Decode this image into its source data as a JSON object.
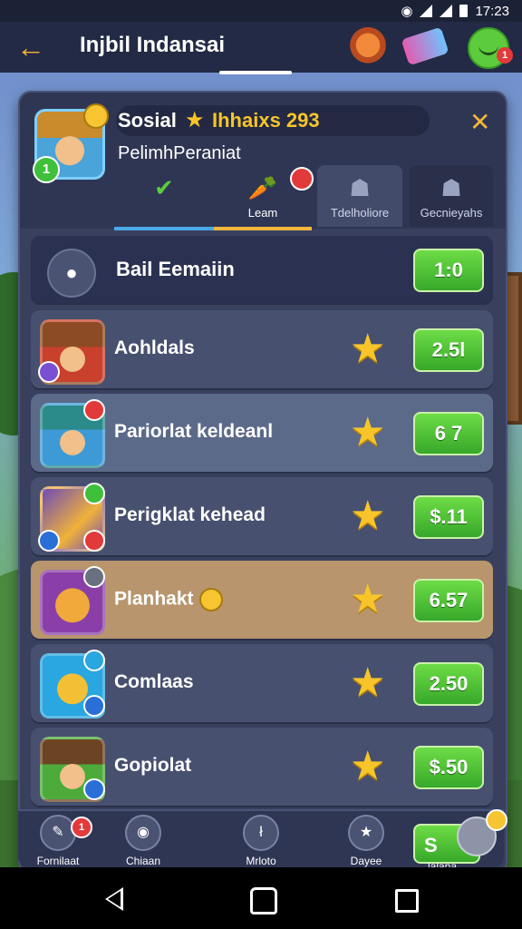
{
  "status_bar": {
    "time": "17:23"
  },
  "header": {
    "back_icon": "arrow-left-icon",
    "title": "Injbil Indansai",
    "notification_count": "1"
  },
  "profile": {
    "name": "Sosial",
    "rank_text": "Ihhaixs 293",
    "subtitle": "PelimhPeraniat",
    "level": "1"
  },
  "tabs": [
    {
      "label": "",
      "icon": "check-icon"
    },
    {
      "label": "Leam",
      "icon": "carrot-icon"
    },
    {
      "label": "Tdelholiore",
      "icon": "group-icon"
    },
    {
      "label": "Gecnieyahs",
      "icon": "group-gear-icon"
    }
  ],
  "list_header": {
    "label": "Bail Eemaiin",
    "score": "1:0"
  },
  "rows": [
    {
      "name": "Aohldals",
      "score": "2.5l"
    },
    {
      "name": "Pariorlat keldeanl",
      "score": "6 7"
    },
    {
      "name": "Perigklat kehead",
      "score": "$.11"
    },
    {
      "name": "Planhakt",
      "score": "6.57"
    },
    {
      "name": "Comlaas",
      "score": "2.50"
    },
    {
      "name": "Gopiolat",
      "score": "$.50"
    }
  ],
  "bottom_nav": [
    {
      "label": "Fornilaat",
      "badge": "1"
    },
    {
      "label": "Chiaan"
    },
    {
      "label": "Mrloto"
    },
    {
      "label": "Dayee"
    },
    {
      "label": "lalana",
      "button_text": "S"
    }
  ],
  "colors": {
    "accent": "#f4b63a",
    "score_green": "#37a82a",
    "panel": "#38405e",
    "highlight_row": "#b8956c"
  }
}
